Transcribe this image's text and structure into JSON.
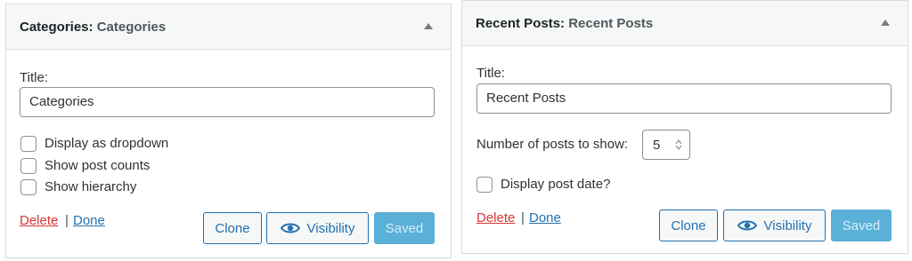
{
  "categories_widget": {
    "title": "Categories",
    "title_sep": ":",
    "subtitle": "Categories",
    "title_label": "Title:",
    "title_value": "Categories",
    "options": [
      {
        "label": "Display as dropdown",
        "checked": false
      },
      {
        "label": "Show post counts",
        "checked": false
      },
      {
        "label": "Show hierarchy",
        "checked": false
      }
    ],
    "delete_label": "Delete",
    "separator": "|",
    "done_label": "Done",
    "clone_label": "Clone",
    "visibility_label": "Visibility",
    "saved_label": "Saved"
  },
  "recent_posts_widget": {
    "title": "Recent Posts",
    "title_sep": ":",
    "subtitle": "Recent Posts",
    "title_label": "Title:",
    "title_value": "Recent Posts",
    "number_label": "Number of posts to show:",
    "number_value": "5",
    "display_date_label": "Display post date?",
    "display_date_checked": false,
    "delete_label": "Delete",
    "separator": "|",
    "done_label": "Done",
    "clone_label": "Clone",
    "visibility_label": "Visibility",
    "saved_label": "Saved"
  },
  "colors": {
    "accent": "#2271b1",
    "delete": "#d63638",
    "saved_bg": "#5ab0d6"
  },
  "icons": {
    "toggle": "triangle-up-icon",
    "visibility": "eye-icon",
    "spinner": "up-down-spinner-icon"
  }
}
